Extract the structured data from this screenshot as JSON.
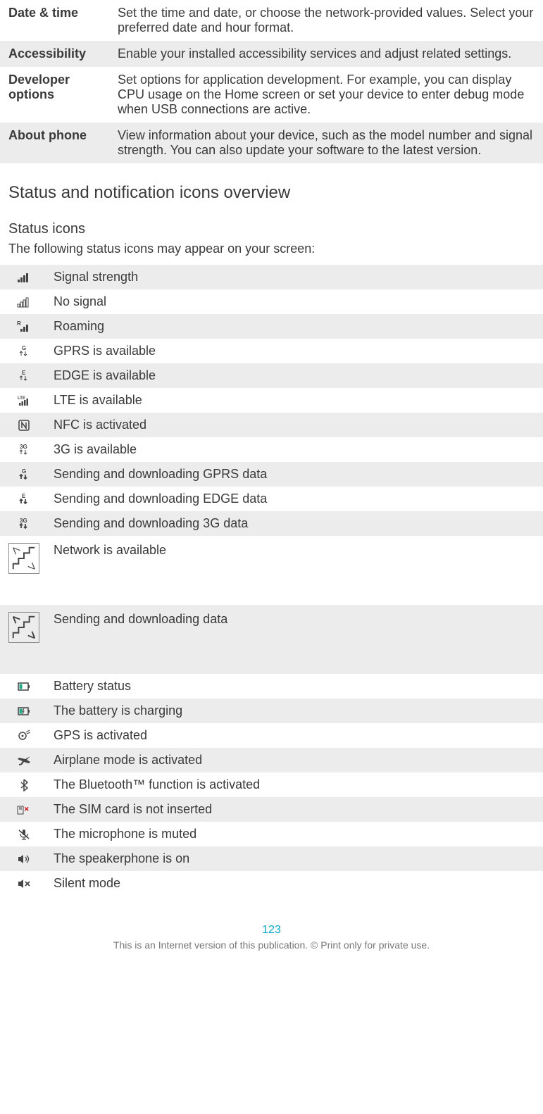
{
  "settings_table": {
    "rows": [
      {
        "label": "Date & time",
        "desc": "Set the time and date, or choose the network-provided values. Select your preferred date and hour format."
      },
      {
        "label": "Accessibility",
        "desc": "Enable your installed accessibility services and adjust related settings."
      },
      {
        "label": "Developer options",
        "desc": "Set options for application development. For example, you can display CPU usage on the Home screen or set your device to enter debug mode when USB connections are active."
      },
      {
        "label": "About phone",
        "desc": "View information about your device, such as the model number and signal strength. You can also update your software to the latest version."
      }
    ]
  },
  "section_heading": "Status and notification icons overview",
  "sub_heading": "Status icons",
  "intro_text": "The following status icons may appear on your screen:",
  "status_icons": {
    "rows": [
      {
        "icon": "signal-strength-icon",
        "desc": "Signal strength"
      },
      {
        "icon": "no-signal-icon",
        "desc": "No signal"
      },
      {
        "icon": "roaming-icon",
        "desc": "Roaming"
      },
      {
        "icon": "gprs-available-icon",
        "desc": "GPRS is available"
      },
      {
        "icon": "edge-available-icon",
        "desc": "EDGE is available"
      },
      {
        "icon": "lte-available-icon",
        "desc": "LTE is available"
      },
      {
        "icon": "nfc-activated-icon",
        "desc": "NFC is activated"
      },
      {
        "icon": "3g-available-icon",
        "desc": "3G is available"
      },
      {
        "icon": "gprs-data-icon",
        "desc": "Sending and downloading GPRS data"
      },
      {
        "icon": "edge-data-icon",
        "desc": "Sending and downloading EDGE data"
      },
      {
        "icon": "3g-data-icon",
        "desc": "Sending and downloading 3G data"
      },
      {
        "icon": "network-available-icon",
        "desc": "Network is available"
      },
      {
        "icon": "data-transfer-icon",
        "desc": "Sending and downloading data"
      },
      {
        "icon": "battery-status-icon",
        "desc": "Battery status"
      },
      {
        "icon": "battery-charging-icon",
        "desc": "The battery is charging"
      },
      {
        "icon": "gps-activated-icon",
        "desc": "GPS is activated"
      },
      {
        "icon": "airplane-mode-icon",
        "desc": "Airplane mode is activated"
      },
      {
        "icon": "bluetooth-icon",
        "desc": "The Bluetooth™ function is activated"
      },
      {
        "icon": "no-sim-icon",
        "desc": "The SIM card is not inserted"
      },
      {
        "icon": "mic-muted-icon",
        "desc": "The microphone is muted"
      },
      {
        "icon": "speakerphone-icon",
        "desc": "The speakerphone is on"
      },
      {
        "icon": "silent-mode-icon",
        "desc": "Silent mode"
      }
    ]
  },
  "page_number": "123",
  "footer_note": "This is an Internet version of this publication. © Print only for private use."
}
